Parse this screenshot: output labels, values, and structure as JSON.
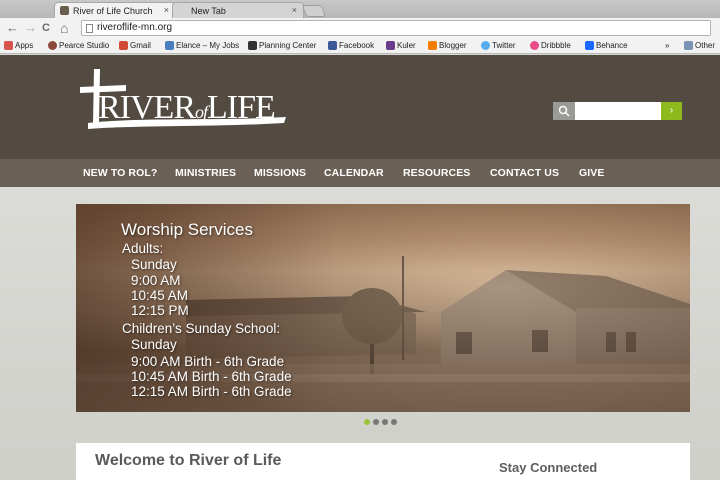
{
  "browser": {
    "tabs": [
      {
        "title": "River of Life Church",
        "close": "×"
      },
      {
        "title": "New Tab",
        "close": "×"
      }
    ],
    "nav": {
      "back": "←",
      "forward": "→",
      "reload": "C",
      "home": "⌂"
    },
    "url": "riveroflife-mn.org",
    "bookmarks": [
      {
        "label": "Apps",
        "icon": "apps-grid-icon",
        "color": "#d9534f"
      },
      {
        "label": "Pearce Studio",
        "icon": "pearce-studio-icon",
        "color": "#8b4a3a"
      },
      {
        "label": "Gmail",
        "icon": "gmail-icon",
        "color": "#d14836"
      },
      {
        "label": "Elance – My Jobs",
        "icon": "elance-icon",
        "color": "#4a7ec1"
      },
      {
        "label": "Planning Center",
        "icon": "planning-center-icon",
        "color": "#333333"
      },
      {
        "label": "Facebook",
        "icon": "facebook-icon",
        "color": "#3b5998"
      },
      {
        "label": "Kuler",
        "icon": "kuler-icon",
        "color": "#6a3c8c"
      },
      {
        "label": "Blogger",
        "icon": "blogger-icon",
        "color": "#f57d00"
      },
      {
        "label": "Twitter",
        "icon": "twitter-icon",
        "color": "#55acee"
      },
      {
        "label": "Dribbble",
        "icon": "dribbble-icon",
        "color": "#ea4c89"
      },
      {
        "label": "Behance",
        "icon": "behance-icon",
        "color": "#1769ff"
      }
    ],
    "more_bookmarks": "»",
    "other_bookmarks": "Other"
  },
  "site": {
    "logo": {
      "river": "RIVER",
      "of": "of",
      "life": "LIFE"
    },
    "search": {
      "placeholder": "",
      "go": "›"
    },
    "nav": [
      "NEW TO ROL?",
      "MINISTRIES",
      "MISSIONS",
      "CALENDAR",
      "RESOURCES",
      "CONTACT US",
      "GIVE"
    ],
    "hero": {
      "title": "Worship Services",
      "lines": [
        "Adults:",
        "Sunday",
        "9:00 AM",
        "10:45 AM",
        "12:15 PM",
        "Children’s Sunday School:",
        "Sunday",
        "9:00 AM Birth - 6th Grade",
        "10:45 AM Birth - 6th Grade",
        "12:15 AM Birth - 6th Grade"
      ]
    },
    "slider": {
      "count": 4,
      "active_index": 0
    },
    "welcome": "Welcome to River of Life",
    "stay_connected": "Stay Connected"
  },
  "colors": {
    "header_bg": "#534b42",
    "nav_bg": "#6b6055",
    "accent_green": "#8dbb1e"
  }
}
